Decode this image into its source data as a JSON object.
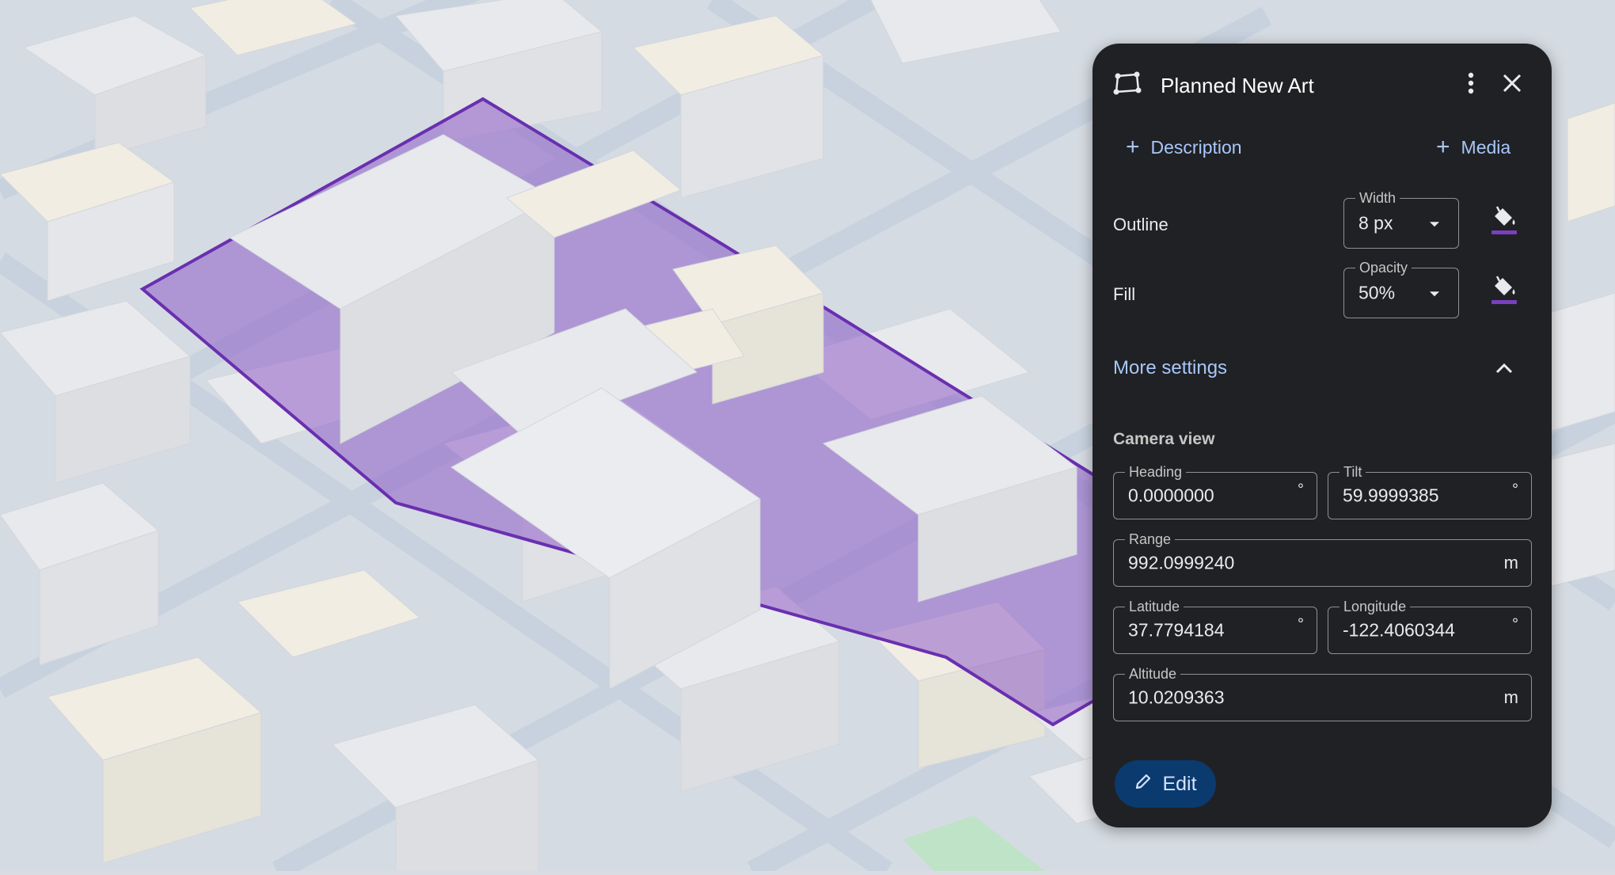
{
  "panel": {
    "title": "Planned New Art",
    "icons": {
      "shape": "polygon-icon",
      "menu": "more-vert-icon",
      "close": "close-icon",
      "paint": "paint-bucket-icon",
      "collapse": "chevron-up-icon",
      "edit": "pencil-icon"
    },
    "add_description": "Description",
    "add_media": "Media",
    "outline": {
      "label": "Outline",
      "width_legend": "Width",
      "width_value": "8 px",
      "color": "#7a3fbf"
    },
    "fill": {
      "label": "Fill",
      "opacity_legend": "Opacity",
      "opacity_value": "50%",
      "color": "#7a3fbf"
    },
    "more_settings": "More settings",
    "camera": {
      "title": "Camera view",
      "heading_legend": "Heading",
      "heading_value": "0.0000000",
      "heading_unit": "°",
      "tilt_legend": "Tilt",
      "tilt_value": "59.9999385",
      "tilt_unit": "°",
      "range_legend": "Range",
      "range_value": "992.0999240",
      "range_unit": "m",
      "lat_legend": "Latitude",
      "lat_value": "37.7794184",
      "lat_unit": "°",
      "lng_legend": "Longitude",
      "lng_value": "-122.4060344",
      "lng_unit": "°",
      "alt_legend": "Altitude",
      "alt_value": "10.0209363",
      "alt_unit": "m"
    },
    "edit_label": "Edit"
  },
  "map": {
    "polygon_color": "#8e5cc9",
    "building_color": "#e8e9ec",
    "building_warm_color": "#f1ede2",
    "street_color": "#c8d3df",
    "park_color": "#bfe3c6"
  }
}
